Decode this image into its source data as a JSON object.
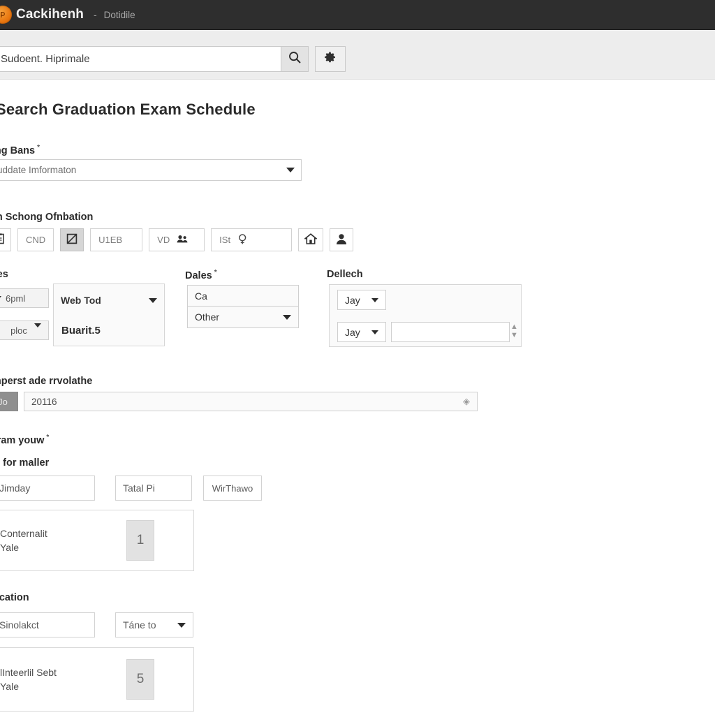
{
  "titlebar": {
    "logo_icon": "orange-circle-logo",
    "app_name": "Cackihenh",
    "separator": "-",
    "subtitle": "Dotidile"
  },
  "searchbar": {
    "input_value": "Sudoent. Hiprimale",
    "input_placeholder": "Sudoent. Hiprimale",
    "search_icon": "search-icon",
    "settings_icon": "gear-icon"
  },
  "page": {
    "title": "Search Graduation Exam Schedule"
  },
  "bang_field": {
    "label": "ung Bans",
    "required_mark": "*",
    "selected": "uddate Imformaton",
    "caret_icon": "chevron-down-icon"
  },
  "school_section": {
    "label": "gh Schong Ofnbation",
    "chips": [
      {
        "name": "chip-doc",
        "text": "",
        "icon": "document-icon",
        "selected": false
      },
      {
        "name": "chip-cnd",
        "text": "CND",
        "icon": "",
        "selected": false
      },
      {
        "name": "chip-checkbox",
        "text": "",
        "icon": "checkbox-icon",
        "selected": true
      },
      {
        "name": "chip-uteb",
        "text": "U1EB",
        "icon": "",
        "selected": false
      },
      {
        "name": "chip-vd",
        "text": "VD",
        "icon": "people-icon",
        "selected": false
      },
      {
        "name": "chip-ist",
        "text": "ISt",
        "icon": "magnifier-icon",
        "selected": false
      },
      {
        "name": "chip-home",
        "text": "",
        "icon": "home-icon",
        "selected": false
      },
      {
        "name": "chip-user",
        "text": "",
        "icon": "person-icon",
        "selected": false
      }
    ]
  },
  "columns": {
    "a": {
      "label": "ttes",
      "mini_select_1": "6pml",
      "mini_select_2": "ploc",
      "box_select_top": "Web Tod",
      "box_text_bottom": "Buarit.5"
    },
    "b": {
      "label": "Dales",
      "required_mark": "*",
      "option_1": "Ca",
      "option_2": "Other"
    },
    "c": {
      "label": "Dellech",
      "select_top": "Jay",
      "select_bottom": "Jay",
      "input_value": "",
      "spinner_icon": "spinner-updown-icon"
    }
  },
  "number_field": {
    "label": "unperst ade rrvolathe",
    "prefix": "Jo",
    "value": "20116",
    "trailing_icon": "droplet-icon"
  },
  "sram_section": {
    "label": "Sram youw",
    "required_mark": "*",
    "sub_label": "ile for maller",
    "input_value": "Jimday",
    "button_1": "Tatal Pi",
    "button_2": "WirThawo",
    "panel_text": "Conternalit\nYale",
    "panel_number": "1"
  },
  "location_section": {
    "label": "ocation",
    "input_value": "Sinolakct",
    "select_value": "Táne to",
    "caret_icon": "chevron-down-icon",
    "panel_text": "lInteerlil Sebt\nYale",
    "panel_number": "5"
  },
  "colors": {
    "titlebar_bg": "#2e2e2e",
    "accent_logo": "#e8760f",
    "searchbar_bg": "#ededed",
    "page_bg": "#ffffff",
    "text_primary": "#2b2b2b",
    "border": "#d2d2d2"
  }
}
